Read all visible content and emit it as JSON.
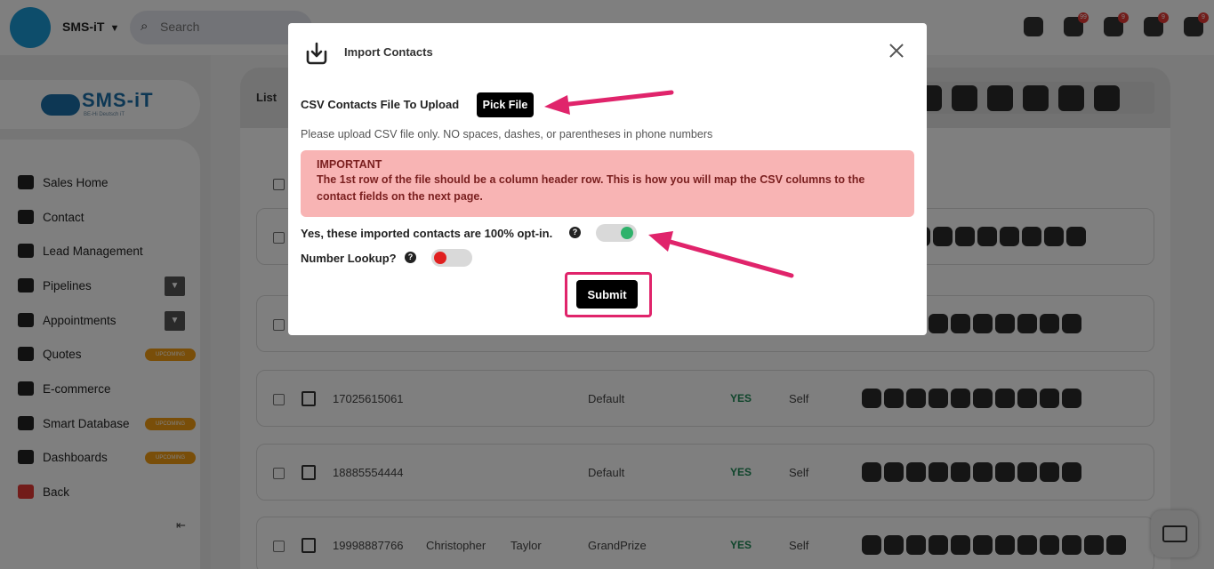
{
  "topbar": {
    "brand": "SMS-iT",
    "search_placeholder": "Search",
    "badges": [
      "99",
      "9",
      "9",
      "9"
    ]
  },
  "sidebar": {
    "logo_text": "SMS-iT",
    "logo_sub": "BE-Hi Deutsch iT",
    "items": [
      {
        "label": "Sales Home",
        "icon": "home-icon"
      },
      {
        "label": "Contact",
        "icon": "user-icon"
      },
      {
        "label": "Lead Management",
        "icon": "network-icon"
      },
      {
        "label": "Pipelines",
        "icon": "pipeline-icon",
        "expandable": true
      },
      {
        "label": "Appointments",
        "icon": "calendar-check-icon",
        "expandable": true
      },
      {
        "label": "Quotes",
        "icon": "quote-icon",
        "badge": "UPCOMING"
      },
      {
        "label": "E-commerce",
        "icon": "cart-icon"
      },
      {
        "label": "Smart Database",
        "icon": "database-icon",
        "badge": "UPCOMING"
      },
      {
        "label": "Dashboards",
        "icon": "dashboard-icon",
        "badge": "UPCOMING"
      },
      {
        "label": "Back",
        "icon": "back-icon"
      }
    ]
  },
  "main": {
    "title": "List",
    "rows": [
      {
        "phone": "",
        "first": "",
        "last": "",
        "group": "",
        "optin": "",
        "source": ""
      },
      {
        "phone": "",
        "first": "",
        "last": "",
        "group": "",
        "optin": "",
        "source": ""
      },
      {
        "phone": "17025615061",
        "first": "",
        "last": "",
        "group": "Default",
        "optin": "YES",
        "source": "Self"
      },
      {
        "phone": "18885554444",
        "first": "",
        "last": "",
        "group": "Default",
        "optin": "YES",
        "source": "Self"
      },
      {
        "phone": "19998887766",
        "first": "Christopher",
        "last": "Taylor",
        "group": "GrandPrize",
        "optin": "YES",
        "source": "Self"
      }
    ]
  },
  "modal": {
    "title": "Import Contacts",
    "csv_label": "CSV Contacts File To Upload",
    "pick_file_label": "Pick File",
    "hint": "Please upload CSV file only. NO spaces, dashes, or parentheses in phone numbers",
    "alert_title": "IMPORTANT",
    "alert_text": "The 1st row of the file should be a column header row. This is how you will map the CSV columns to the contact fields on the next page.",
    "optin_label": "Yes, these imported contacts are 100% opt-in.",
    "optin_on": true,
    "lookup_label": "Number Lookup?",
    "lookup_on": false,
    "submit_label": "Submit",
    "help_glyph": "?"
  },
  "colors": {
    "accent_pink": "#e0246b",
    "toggle_on": "#2fb26b",
    "toggle_off": "#e02020",
    "alert_bg": "#f8b4b4"
  }
}
